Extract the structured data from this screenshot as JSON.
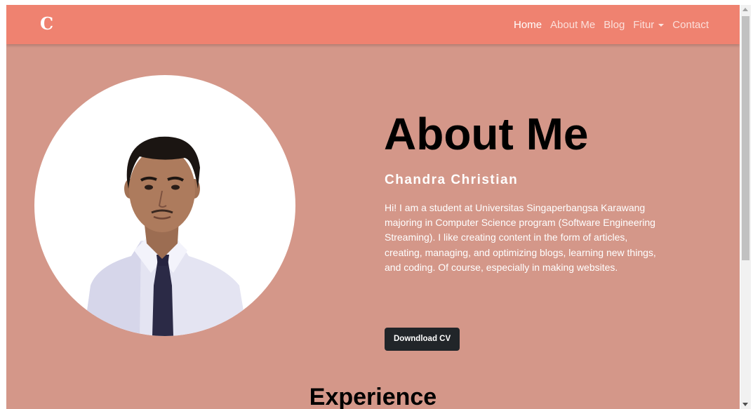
{
  "navbar": {
    "brand": "C",
    "links": [
      {
        "label": "Home",
        "active": true
      },
      {
        "label": "About Me"
      },
      {
        "label": "Blog"
      },
      {
        "label": "Fitur",
        "dropdown": true
      },
      {
        "label": "Contact"
      }
    ]
  },
  "hero": {
    "title": "About Me",
    "name": "Chandra Christian",
    "bio": "Hi! I am a student at Universitas Singaperbangsa Karawang majoring in Computer Science program (Software Engineering Streaming). I like creating content in the form of articles, creating, managing, and optimizing blogs, learning new things, and coding. Of course, especially in making websites.",
    "cv_button": "Downdload CV"
  },
  "next_section": {
    "title": "Experience"
  },
  "colors": {
    "navbar": "#ef8270",
    "page_background": "#d49789",
    "button": "#212529"
  }
}
